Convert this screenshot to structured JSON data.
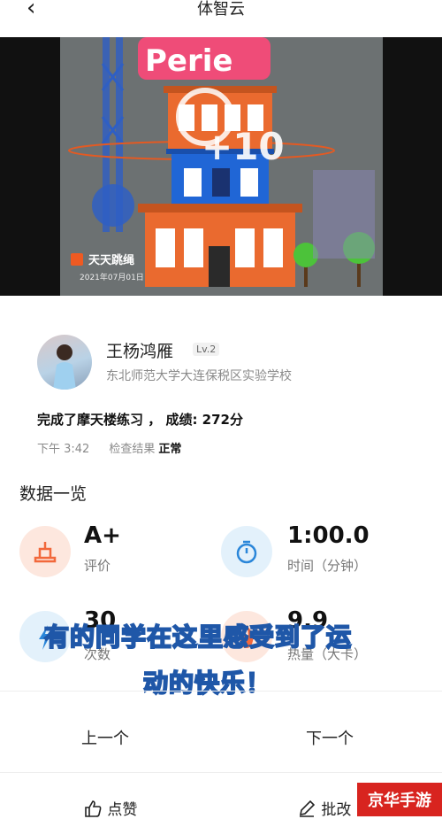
{
  "nav": {
    "back_icon": "chevron-left-icon",
    "back_glyph": "‹",
    "title": "体智云"
  },
  "video": {
    "sign_text": "Perie",
    "score_popup": "+10",
    "brand": "天天跳绳",
    "date": "2021年07月01日"
  },
  "user": {
    "name": "王杨鸿雁",
    "level": "Lv.2",
    "school": "东北师范大学大连保税区实验学校"
  },
  "record": {
    "summary": "完成了摩天楼练习 ， 成绩: 272分",
    "time": "下午 3:42",
    "check_label": "检查结果",
    "check_value": "正常"
  },
  "overview": {
    "title": "数据一览",
    "rating": {
      "value": "A+",
      "label": "评价",
      "icon": "podium-icon"
    },
    "duration": {
      "value": "1:00.0",
      "label": "时间（分钟）",
      "icon": "stopwatch-icon"
    },
    "count": {
      "value": "30",
      "label": "次数",
      "icon": "bolt-icon"
    },
    "calories": {
      "value": "9.9",
      "label": "热量（大卡）",
      "icon": "flame-icon"
    }
  },
  "caption": {
    "line1": "有的同学在这里感受到了运",
    "line2": "动的快乐！"
  },
  "pager": {
    "prev": "上一个",
    "next": "下一个"
  },
  "actions": {
    "like": "点赞",
    "review": "批改"
  },
  "watermark": "京华手游",
  "colors": {
    "accent_orange": "#f2683b",
    "accent_blue": "#2a86d9",
    "caption_outline": "#1f57a8"
  }
}
